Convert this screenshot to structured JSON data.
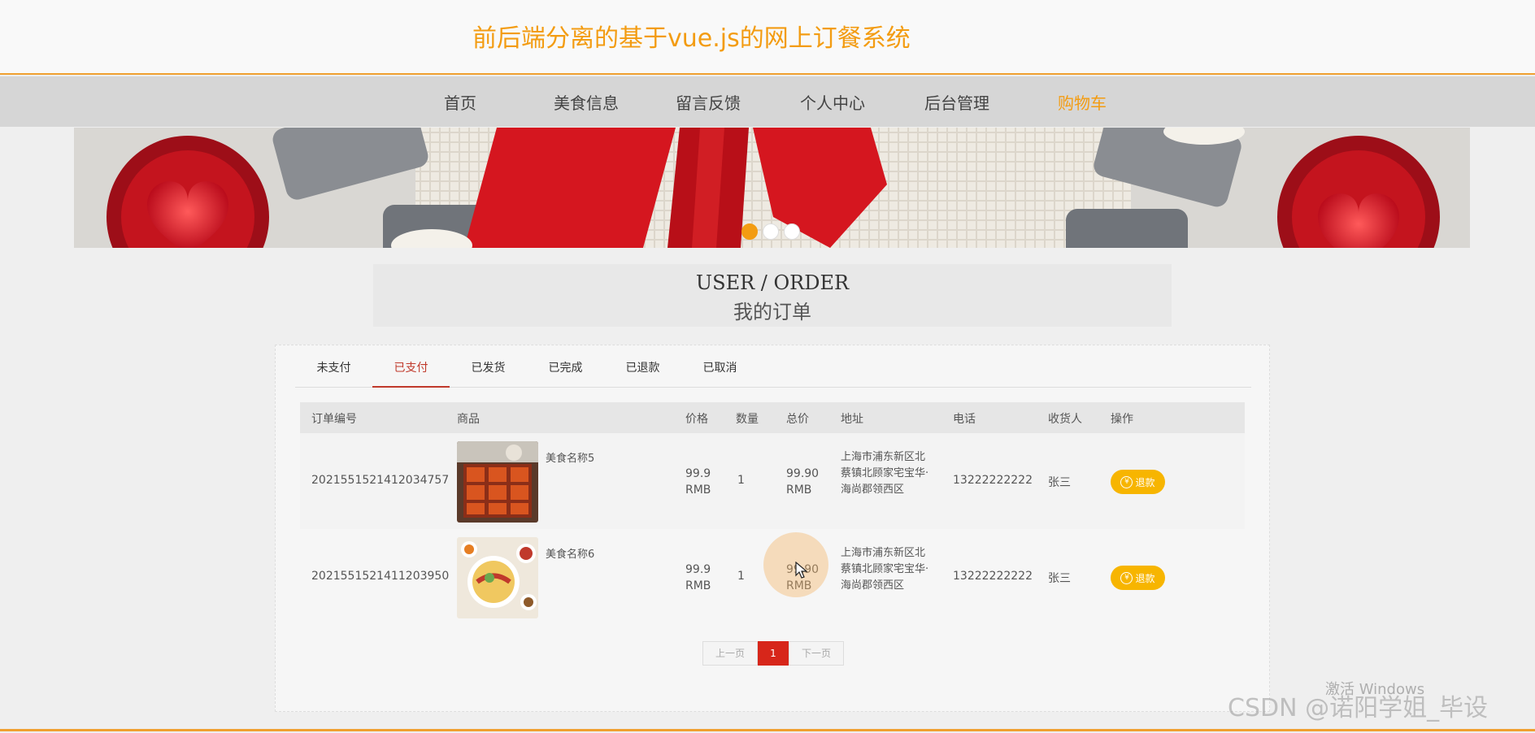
{
  "site": {
    "title": "前后端分离的基于vue.js的网上订餐系统"
  },
  "nav": {
    "items": [
      {
        "label": "首页"
      },
      {
        "label": "美食信息"
      },
      {
        "label": "留言反馈"
      },
      {
        "label": "个人中心"
      },
      {
        "label": "后台管理"
      },
      {
        "label": "购物车"
      }
    ],
    "active_index": 5
  },
  "banner": {
    "dots": 3,
    "active_dot": 0
  },
  "heading": {
    "en": "USER / ORDER",
    "zh": "我的订单"
  },
  "tabs": {
    "items": [
      {
        "label": "未支付"
      },
      {
        "label": "已支付"
      },
      {
        "label": "已发货"
      },
      {
        "label": "已完成"
      },
      {
        "label": "已退款"
      },
      {
        "label": "已取消"
      }
    ],
    "active_index": 1
  },
  "table": {
    "headers": [
      "订单编号",
      "商品",
      "价格",
      "数量",
      "总价",
      "地址",
      "电话",
      "收货人",
      "操作"
    ],
    "rows": [
      {
        "order_no": "20215515214120347 57",
        "product_name": "美食名称5",
        "price": "99.9",
        "price_unit": "RMB",
        "qty": "1",
        "total": "99.90",
        "total_unit": "RMB",
        "address": "上海市浦东新区北蔡镇北顾家宅宝华·海尚郡领西区",
        "phone": "13222222222",
        "receiver": "张三",
        "action": "退款"
      },
      {
        "order_no": "2021551521411203950",
        "product_name": "美食名称6",
        "price": "99.9",
        "price_unit": "RMB",
        "qty": "1",
        "total": "99.90",
        "total_unit": "RMB",
        "address": "上海市浦东新区北蔡镇北顾家宅宝华·海尚郡领西区",
        "phone": "13222222222",
        "receiver": "张三",
        "action": "退款"
      }
    ]
  },
  "pager": {
    "prev": "上一页",
    "current": "1",
    "next": "下一页"
  },
  "overlay": {
    "windows": "激活 Windows",
    "csdn": "CSDN @诺阳学姐_毕设"
  },
  "colors": {
    "accent": "#f39c12",
    "active_tab": "#c0392b",
    "page_current": "#d7261a",
    "refund_btn": "#f7b500"
  }
}
